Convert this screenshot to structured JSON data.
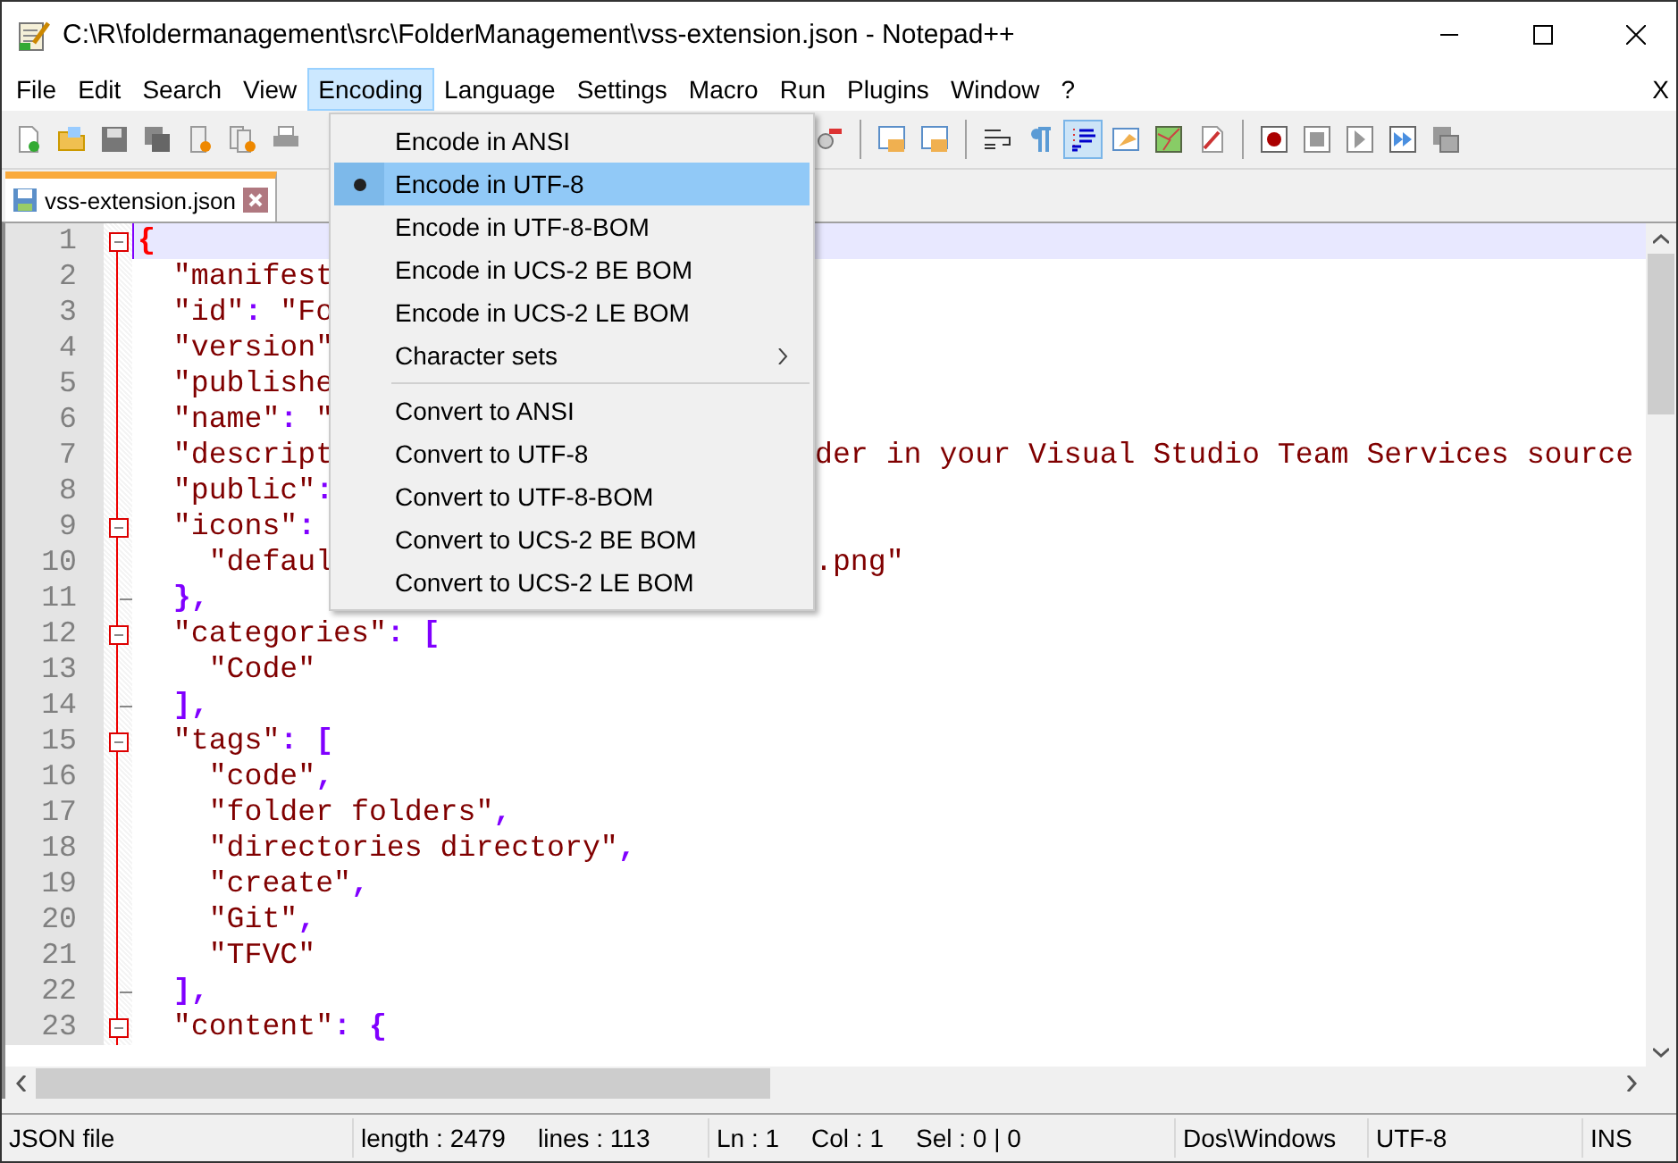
{
  "window": {
    "title": "C:\\R\\foldermanagement\\src\\FolderManagement\\vss-extension.json - Notepad++"
  },
  "menu_bar": {
    "items": [
      {
        "label": "File",
        "selected": false
      },
      {
        "label": "Edit",
        "selected": false
      },
      {
        "label": "Search",
        "selected": false
      },
      {
        "label": "View",
        "selected": false
      },
      {
        "label": "Encoding",
        "selected": true
      },
      {
        "label": "Language",
        "selected": false
      },
      {
        "label": "Settings",
        "selected": false
      },
      {
        "label": "Macro",
        "selected": false
      },
      {
        "label": "Run",
        "selected": false
      },
      {
        "label": "Plugins",
        "selected": false
      },
      {
        "label": "Window",
        "selected": false
      },
      {
        "label": "?",
        "selected": false
      }
    ],
    "close_label": "X"
  },
  "toolbar": {
    "left": [
      {
        "kind": "new",
        "selected": false
      },
      {
        "kind": "open",
        "selected": false
      },
      {
        "kind": "save",
        "selected": false
      },
      {
        "kind": "save_all",
        "selected": false
      },
      {
        "kind": "close",
        "selected": false
      },
      {
        "kind": "close_all",
        "selected": false
      },
      {
        "kind": "print",
        "selected": false
      }
    ],
    "right": [
      {
        "kind": "find",
        "selected": false
      },
      {
        "kind": "sep"
      },
      {
        "kind": "lock",
        "selected": false
      },
      {
        "kind": "lock",
        "selected": false
      },
      {
        "kind": "sep"
      },
      {
        "kind": "wrap",
        "selected": false
      },
      {
        "kind": "pilcrow",
        "selected": false
      },
      {
        "kind": "indent",
        "selected": true
      },
      {
        "kind": "window",
        "selected": false
      },
      {
        "kind": "map",
        "selected": false
      },
      {
        "kind": "doc",
        "selected": false
      },
      {
        "kind": "sep"
      },
      {
        "kind": "record",
        "selected": false
      },
      {
        "kind": "stop",
        "selected": false
      },
      {
        "kind": "play",
        "selected": false
      },
      {
        "kind": "fast",
        "selected": false
      },
      {
        "kind": "list",
        "selected": false
      }
    ]
  },
  "tabs": [
    {
      "label": "vss-extension.json",
      "selected": true
    }
  ],
  "encoding_menu": {
    "items": [
      {
        "kind": "item",
        "label": "Encode in ANSI",
        "checked": false,
        "selected": false
      },
      {
        "kind": "item",
        "label": "Encode in UTF-8",
        "checked": true,
        "selected": true
      },
      {
        "kind": "item",
        "label": "Encode in UTF-8-BOM",
        "checked": false,
        "selected": false
      },
      {
        "kind": "item",
        "label": "Encode in UCS-2 BE BOM",
        "checked": false,
        "selected": false
      },
      {
        "kind": "item",
        "label": "Encode in UCS-2 LE BOM",
        "checked": false,
        "selected": false
      },
      {
        "kind": "submenu",
        "label": "Character sets",
        "checked": false,
        "selected": false
      },
      {
        "kind": "separator"
      },
      {
        "kind": "item",
        "label": "Convert to ANSI",
        "checked": false,
        "selected": false
      },
      {
        "kind": "item",
        "label": "Convert to UTF-8",
        "checked": false,
        "selected": false
      },
      {
        "kind": "item",
        "label": "Convert to UTF-8-BOM",
        "checked": false,
        "selected": false
      },
      {
        "kind": "item",
        "label": "Convert to UCS-2 BE BOM",
        "checked": false,
        "selected": false
      },
      {
        "kind": "item",
        "label": "Convert to UCS-2 LE BOM",
        "checked": false,
        "selected": false
      }
    ]
  },
  "editor": {
    "lines": [
      {
        "number": "1",
        "fold_start": true,
        "current": true,
        "segments": [
          {
            "kind": "brace_match",
            "text": "{"
          }
        ]
      },
      {
        "number": "2",
        "segments": [
          {
            "kind": "string",
            "text": "  \"manifest"
          }
        ]
      },
      {
        "number": "3",
        "segments": [
          {
            "kind": "string",
            "text": "  \"id\""
          },
          {
            "kind": "operator",
            "text": ": "
          },
          {
            "kind": "string",
            "text": "\"Fo"
          }
        ]
      },
      {
        "number": "4",
        "segments": [
          {
            "kind": "string",
            "text": "  \"version\""
          }
        ]
      },
      {
        "number": "5",
        "segments": [
          {
            "kind": "string",
            "text": "  \"publishe"
          }
        ]
      },
      {
        "number": "6",
        "segments": [
          {
            "kind": "string",
            "text": "  \"name\""
          },
          {
            "kind": "operator",
            "text": ": "
          },
          {
            "kind": "string",
            "text": "\""
          }
        ]
      },
      {
        "number": "7",
        "segments": [
          {
            "kind": "string",
            "text": "  \"descript"
          }
        ],
        "tail": "der in your Visual Studio Team Services source"
      },
      {
        "number": "8",
        "segments": [
          {
            "kind": "string",
            "text": "  \"public\""
          },
          {
            "kind": "operator",
            "text": ":"
          }
        ]
      },
      {
        "number": "9",
        "fold_start": true,
        "segments": [
          {
            "kind": "string",
            "text": "  \"icons\""
          },
          {
            "kind": "operator",
            "text": ":"
          }
        ]
      },
      {
        "number": "10",
        "segments": [
          {
            "kind": "string",
            "text": "    \"defaul"
          }
        ],
        "tail": ".png\""
      },
      {
        "number": "11",
        "fold_end": true,
        "segments": [
          {
            "kind": "operator",
            "text": "  },"
          }
        ]
      },
      {
        "number": "12",
        "fold_start": true,
        "segments": [
          {
            "kind": "string",
            "text": "  \"categories\""
          },
          {
            "kind": "operator",
            "text": ": ["
          }
        ]
      },
      {
        "number": "13",
        "segments": [
          {
            "kind": "string",
            "text": "    \"Code\""
          }
        ]
      },
      {
        "number": "14",
        "fold_end": true,
        "segments": [
          {
            "kind": "operator",
            "text": "  ],"
          }
        ]
      },
      {
        "number": "15",
        "fold_start": true,
        "segments": [
          {
            "kind": "string",
            "text": "  \"tags\""
          },
          {
            "kind": "operator",
            "text": ": ["
          }
        ]
      },
      {
        "number": "16",
        "segments": [
          {
            "kind": "string",
            "text": "    \"code\""
          },
          {
            "kind": "operator",
            "text": ","
          }
        ]
      },
      {
        "number": "17",
        "segments": [
          {
            "kind": "string",
            "text": "    \"folder folders\""
          },
          {
            "kind": "operator",
            "text": ","
          }
        ]
      },
      {
        "number": "18",
        "segments": [
          {
            "kind": "string",
            "text": "    \"directories directory\""
          },
          {
            "kind": "operator",
            "text": ","
          }
        ]
      },
      {
        "number": "19",
        "segments": [
          {
            "kind": "string",
            "text": "    \"create\""
          },
          {
            "kind": "operator",
            "text": ","
          }
        ]
      },
      {
        "number": "20",
        "segments": [
          {
            "kind": "string",
            "text": "    \"Git\""
          },
          {
            "kind": "operator",
            "text": ","
          }
        ]
      },
      {
        "number": "21",
        "segments": [
          {
            "kind": "string",
            "text": "    \"TFVC\""
          }
        ]
      },
      {
        "number": "22",
        "fold_end": true,
        "segments": [
          {
            "kind": "operator",
            "text": "  ],"
          }
        ]
      },
      {
        "number": "23",
        "fold_start": true,
        "segments": [
          {
            "kind": "string",
            "text": "  \"content\""
          },
          {
            "kind": "operator",
            "text": ": {"
          }
        ]
      }
    ]
  },
  "status_bar": {
    "sections": [
      [
        "JSON file"
      ],
      [
        "length : 2479",
        "lines : 113"
      ],
      [
        "Ln : 1",
        "Col : 1",
        "Sel : 0 | 0"
      ],
      [
        "Dos\\Windows"
      ],
      [
        "UTF-8"
      ],
      [
        "INS"
      ]
    ]
  }
}
